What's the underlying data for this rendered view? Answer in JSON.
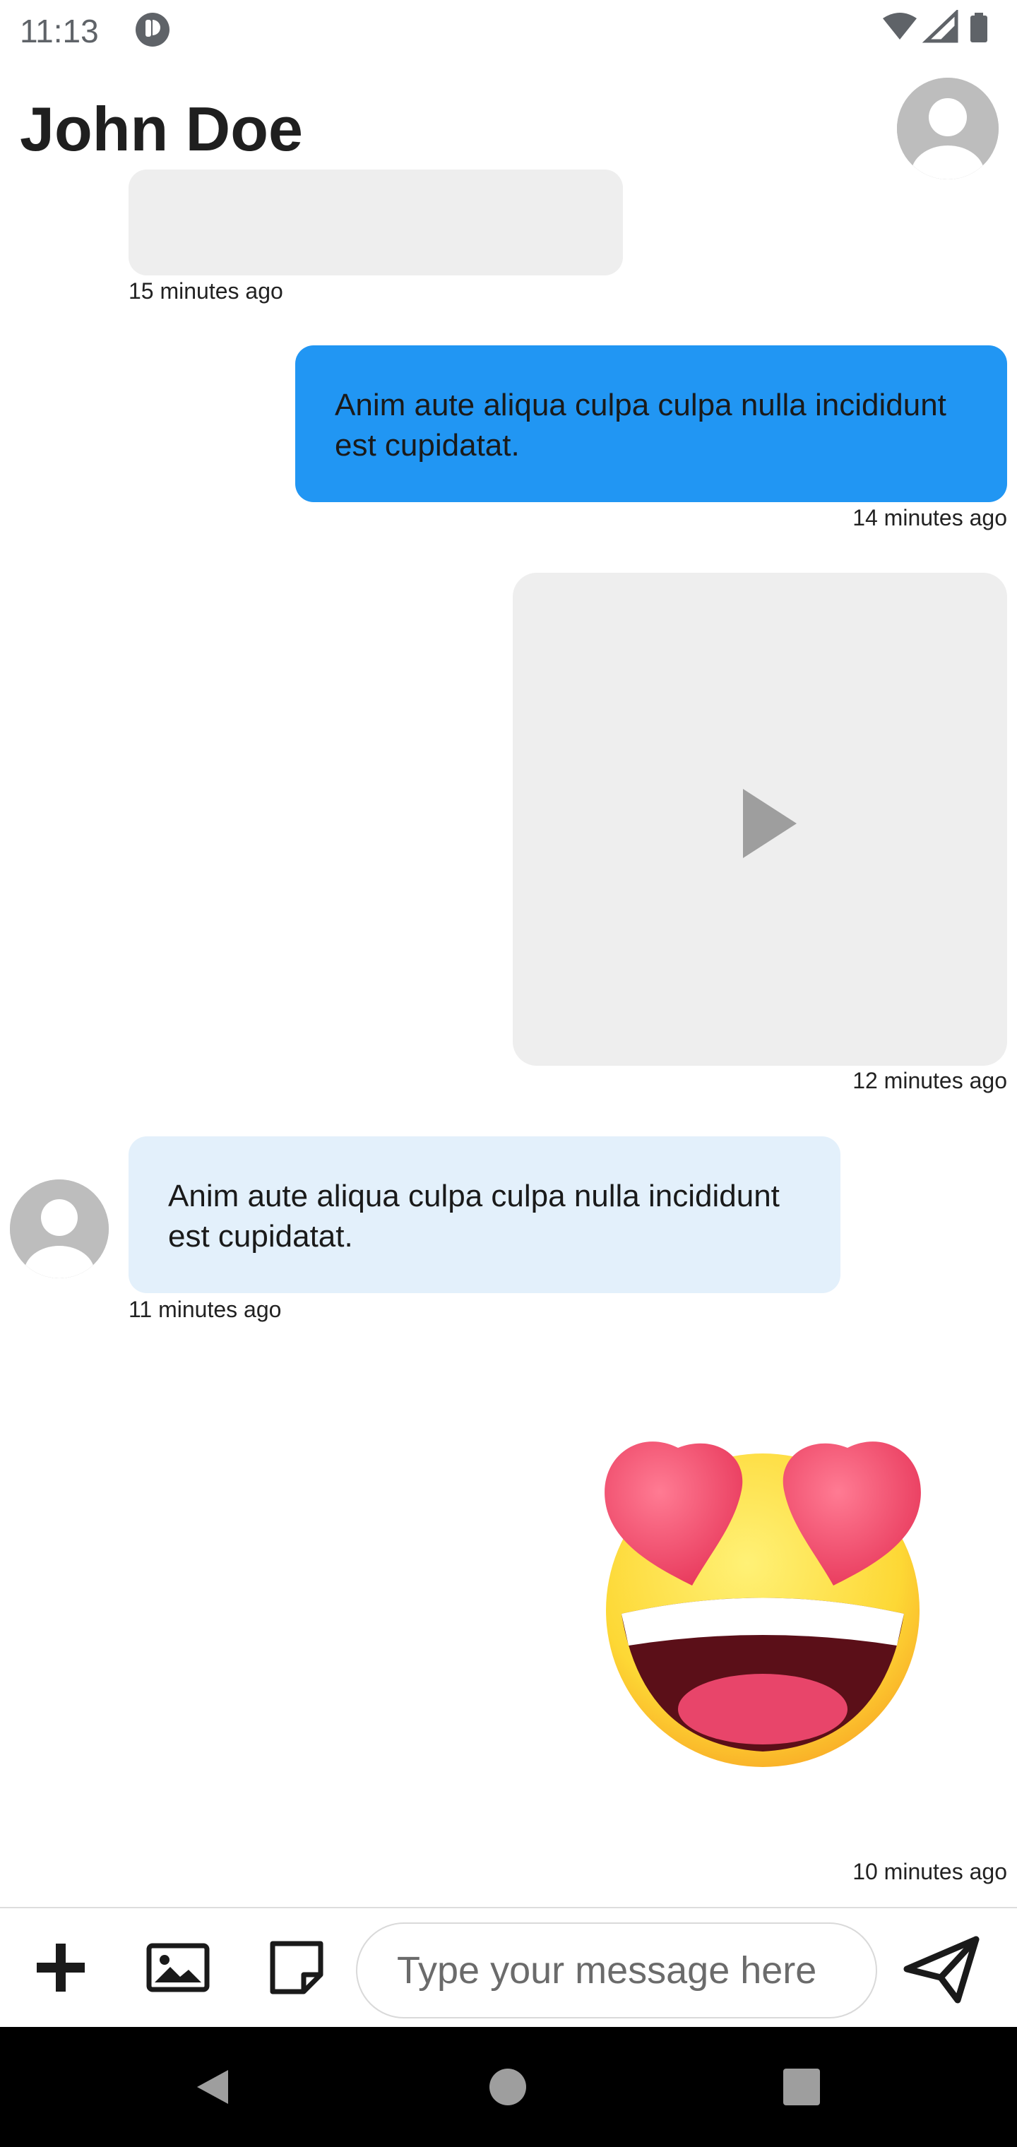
{
  "status_bar": {
    "time": "11:13",
    "icons": [
      "app-badge-icon",
      "wifi-icon",
      "cellular-signal-icon",
      "battery-icon"
    ]
  },
  "header": {
    "title": "John Doe",
    "avatar_icon": "person-avatar-icon"
  },
  "messages": [
    {
      "type": "image",
      "side": "left",
      "timestamp": "15 minutes ago"
    },
    {
      "type": "text",
      "side": "right",
      "text": "Anim aute aliqua culpa culpa nulla incididunt est cupidatat.",
      "timestamp": "14 minutes ago"
    },
    {
      "type": "video",
      "side": "right",
      "icon": "play-icon",
      "timestamp": "12 minutes ago"
    },
    {
      "type": "text",
      "side": "left",
      "text": "Anim aute aliqua culpa culpa nulla incididunt est cupidatat.",
      "timestamp": "11 minutes ago"
    },
    {
      "type": "sticker",
      "side": "right",
      "sticker": "heart-eyes-emoji",
      "timestamp": "10 minutes ago"
    }
  ],
  "input_bar": {
    "placeholder": "Type your message here",
    "value": "",
    "tools": [
      "add-icon",
      "image-icon",
      "sticker-icon"
    ],
    "send_icon": "send-icon"
  },
  "nav_bar": {
    "buttons": [
      "back-icon",
      "home-icon",
      "recents-icon"
    ]
  },
  "colors": {
    "sent_bubble": "#2196f3",
    "received_bubble": "#e3f0fb",
    "media_placeholder": "#eeeeee",
    "nav_bar": "#000000"
  }
}
